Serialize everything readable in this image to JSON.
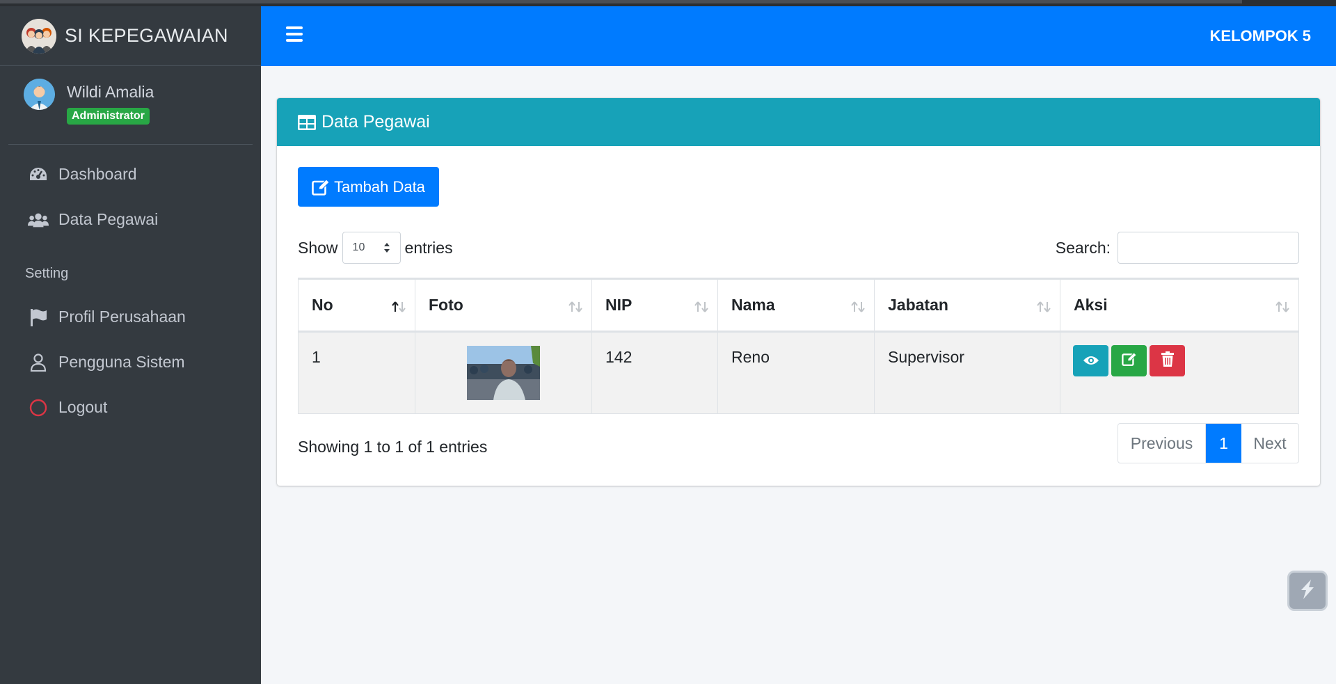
{
  "brand": {
    "title": "SI KEPEGAWAIAN",
    "logo_icon": "team-logo-icon"
  },
  "user": {
    "name": "Wildi Amalia",
    "role": "Administrator",
    "avatar_icon": "user-avatar-icon"
  },
  "sidebar": {
    "items": [
      {
        "label": "Dashboard",
        "icon": "tachometer-icon"
      },
      {
        "label": "Data Pegawai",
        "icon": "users-icon"
      }
    ],
    "section_header": "Setting",
    "setting_items": [
      {
        "label": "Profil Perusahaan",
        "icon": "flag-icon"
      },
      {
        "label": "Pengguna Sistem",
        "icon": "user-icon"
      },
      {
        "label": "Logout",
        "icon": "circle-icon"
      }
    ]
  },
  "navbar": {
    "menu_icon": "hamburger-icon",
    "right_text": "KELOMPOK 5"
  },
  "card": {
    "title": "Data Pegawai",
    "title_icon": "table-icon",
    "add_button": "Tambah Data",
    "show_label": "Show",
    "entries_value": "10",
    "entries_label": "entries",
    "search_label": "Search:",
    "search_value": ""
  },
  "table": {
    "columns": [
      "No",
      "Foto",
      "NIP",
      "Nama",
      "Jabatan",
      "Aksi"
    ],
    "rows": [
      {
        "no": "1",
        "foto": "employee-photo",
        "nip": "142",
        "nama": "Reno",
        "jabatan": "Supervisor"
      }
    ],
    "actions": [
      "eye-icon",
      "edit-icon",
      "trash-icon"
    ]
  },
  "footer": {
    "info": "Showing 1 to 1 of 1 entries",
    "prev": "Previous",
    "page": "1",
    "next": "Next"
  },
  "colors": {
    "sidebar": "#343a40",
    "navbar": "#007bff",
    "card_header": "#17a2b8",
    "success": "#28a745",
    "danger": "#dc3545",
    "info": "#17a2b8"
  }
}
